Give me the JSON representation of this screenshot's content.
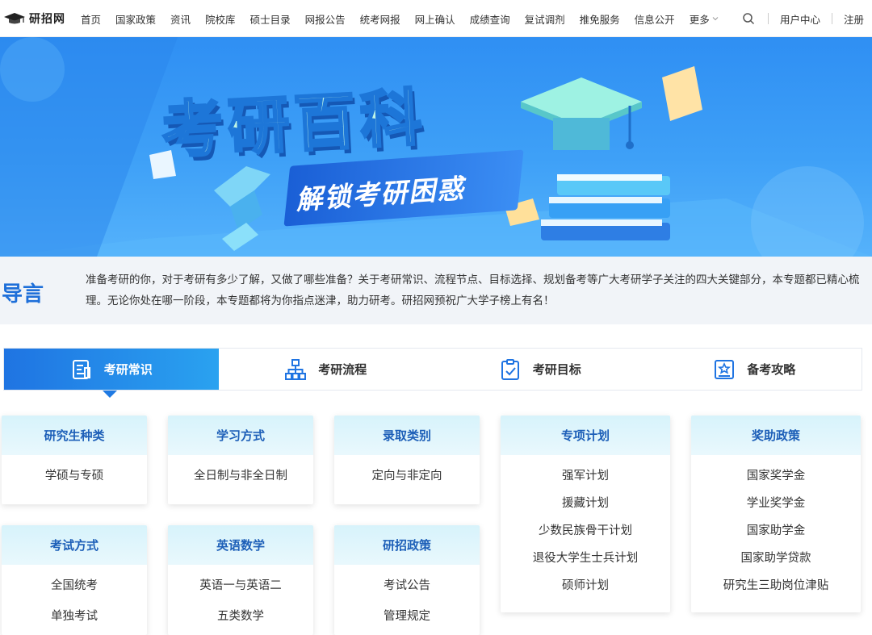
{
  "nav": {
    "logo_text": "研招网",
    "items": [
      "首页",
      "国家政策",
      "资讯",
      "院校库",
      "硕士目录",
      "网报公告",
      "统考网报",
      "网上确认",
      "成绩查询",
      "复试调剂",
      "推免服务",
      "信息公开"
    ],
    "more": "更多",
    "user_center": "用户中心",
    "register": "注册"
  },
  "banner": {
    "title": "考研百科",
    "subtitle": "解锁考研困惑"
  },
  "intro": {
    "label": "导言",
    "text": "准备考研的你，对于考研有多少了解，又做了哪些准备？关于考研常识、流程节点、目标选择、规划备考等广大考研学子关注的四大关键部分，本专题都已精心梳理。无论你处在哪一阶段，本专题都将为你指点迷津，助力研考。研招网预祝广大学子榜上有名！"
  },
  "tabs": [
    {
      "label": "考研常识",
      "icon": "document-icon",
      "active": true
    },
    {
      "label": "考研流程",
      "icon": "flowchart-icon",
      "active": false
    },
    {
      "label": "考研目标",
      "icon": "clipboard-check-icon",
      "active": false
    },
    {
      "label": "备考攻略",
      "icon": "star-book-icon",
      "active": false
    }
  ],
  "cards": [
    {
      "title": "研究生种类",
      "items": [
        "学硕与专硕"
      ]
    },
    {
      "title": "学习方式",
      "items": [
        "全日制与非全日制"
      ]
    },
    {
      "title": "录取类别",
      "items": [
        "定向与非定向"
      ]
    },
    {
      "title": "专项计划",
      "items": [
        "强军计划",
        "援藏计划",
        "少数民族骨干计划",
        "退役大学生士兵计划",
        "硕师计划"
      ]
    },
    {
      "title": "奖助政策",
      "items": [
        "国家奖学金",
        "学业奖学金",
        "国家助学金",
        "国家助学贷款",
        "研究生三助岗位津贴"
      ]
    },
    {
      "title": "考试方式",
      "items": [
        "全国统考",
        "单独考试"
      ]
    },
    {
      "title": "英语数学",
      "items": [
        "英语一与英语二",
        "五类数学"
      ]
    },
    {
      "title": "研招政策",
      "items": [
        "考试公告",
        "管理规定"
      ]
    }
  ]
}
